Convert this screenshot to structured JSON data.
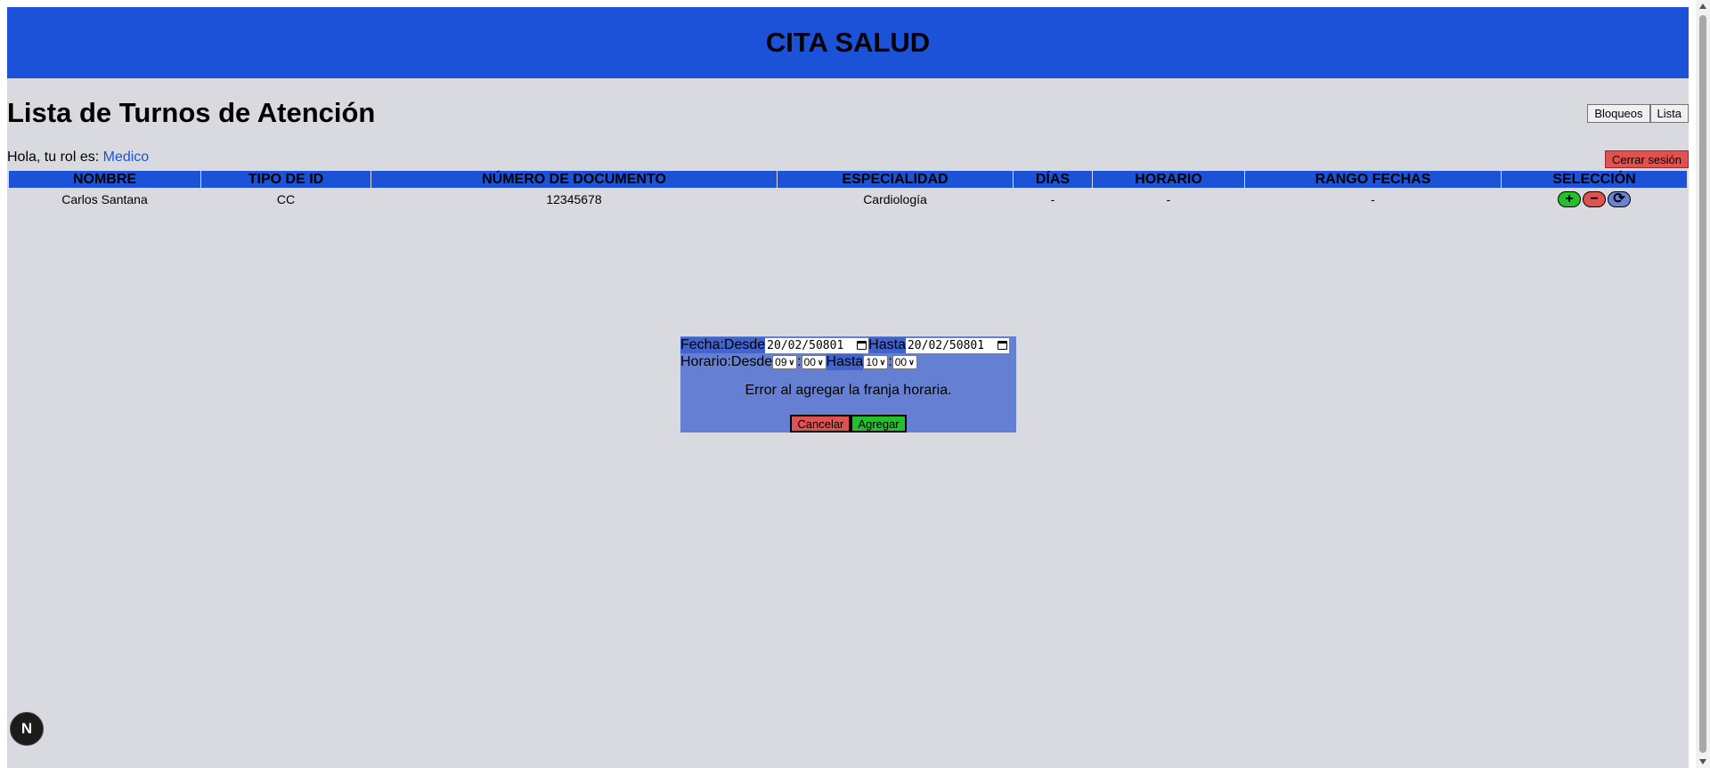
{
  "app": {
    "title": "CITA SALUD"
  },
  "page": {
    "title": "Lista de Turnos de Atención"
  },
  "nav": {
    "bloqueos": "Bloqueos",
    "lista": "Lista"
  },
  "user": {
    "greeting": "Hola, tu rol es: ",
    "role": "Medico",
    "logout": "Cerrar sesión"
  },
  "table": {
    "headers": [
      "NOMBRE",
      "TIPO DE ID",
      "NÚMERO DE DOCUMENTO",
      "ESPECIALIDAD",
      "DÍAS",
      "HORARIO",
      "RANGO FECHAS",
      "SELECCIÓN"
    ],
    "rows": [
      {
        "nombre": "Carlos Santana",
        "tipo_id": "CC",
        "numero_documento": "12345678",
        "especialidad": "Cardiología",
        "dias": "-",
        "horario": "-",
        "rango_fechas": "-"
      }
    ],
    "actions": {
      "add": "+",
      "remove": "−",
      "refresh": "⟳"
    }
  },
  "modal": {
    "fecha_label": "Fecha:Desde",
    "fecha_desde": "20/02/50801",
    "hasta_label": "Hasta",
    "fecha_hasta": "20/02/50801",
    "horario_label": "Horario:Desde",
    "hora_desde": "09",
    "min_desde": "00",
    "separator": ":",
    "horario_hasta_label": "Hasta",
    "hora_hasta": "10",
    "min_hasta": "00",
    "error": "Error al agregar la franja horaria.",
    "cancel": "Cancelar",
    "add": "Agregar"
  },
  "fab": {
    "label": "N"
  },
  "colors": {
    "primary": "#1c52d8",
    "background": "#d9dae0",
    "modal": "#6580d2",
    "danger": "#e0524f",
    "success": "#22c12a"
  }
}
